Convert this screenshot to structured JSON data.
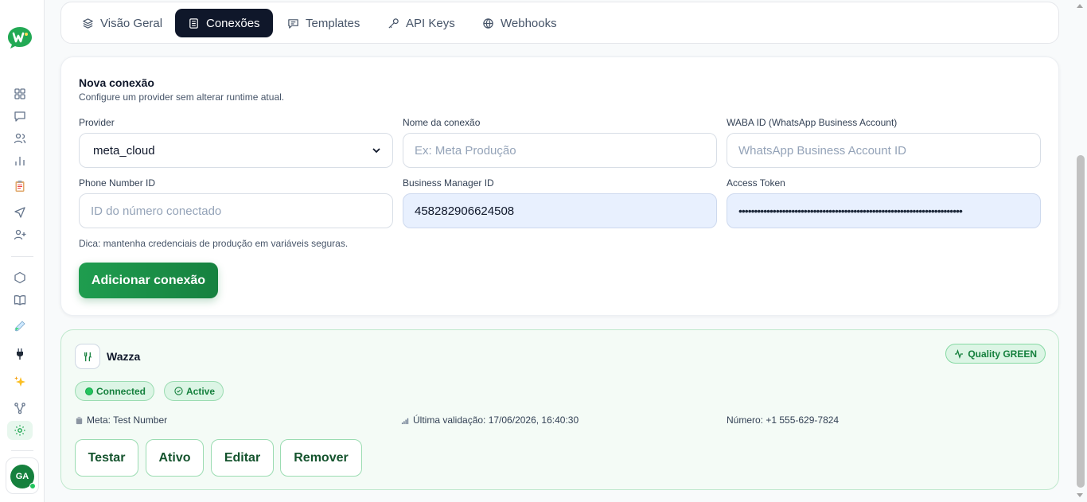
{
  "tabs": [
    {
      "label": "Visão Geral",
      "icon": "layers-icon",
      "active": false
    },
    {
      "label": "Conexões",
      "icon": "plug-list-icon",
      "active": true
    },
    {
      "label": "Templates",
      "icon": "message-square-icon",
      "active": false
    },
    {
      "label": "API Keys",
      "icon": "key-icon",
      "active": false
    },
    {
      "label": "Webhooks",
      "icon": "webhook-icon",
      "active": false
    }
  ],
  "sidebar": {
    "user_initials": "GA",
    "items": [
      "dashboard-icon",
      "chat-icon",
      "contacts-icon",
      "reports-icon",
      "clipboard-icon",
      "send-icon",
      "add-user-icon",
      "box-icon",
      "book-icon",
      "test-tube-icon",
      "plug-icon",
      "sparkles-icon",
      "flow-icon",
      "settings-icon"
    ]
  },
  "form": {
    "title": "Nova conexão",
    "subtitle": "Configure um provider sem alterar runtime atual.",
    "provider_label": "Provider",
    "provider_value": "meta_cloud",
    "name_label": "Nome da conexão",
    "name_placeholder": "Ex: Meta Produção",
    "waba_label": "WABA ID (WhatsApp Business Account)",
    "waba_placeholder": "WhatsApp Business Account ID",
    "phone_label": "Phone Number ID",
    "phone_placeholder": "ID do número conectado",
    "bm_label": "Business Manager ID",
    "bm_value": "458282906624508",
    "token_label": "Access Token",
    "token_value": "••••••••••••••••••••••••••••••••••••••••••••••••••••••••••••••••••••••••",
    "hint": "Dica: mantenha credenciais de produção em variáveis seguras.",
    "submit_label": "Adicionar conexão"
  },
  "connection": {
    "name": "Wazza",
    "quality": "Quality GREEN",
    "status_connected": "Connected",
    "status_active": "Active",
    "meta_label": "Meta: Test Number",
    "validation_label": "Última validação: 17/06/2026, 16:40:30",
    "number_label": "Número: +1 555-629-7824",
    "actions": [
      "Testar",
      "Ativo",
      "Editar",
      "Remover"
    ]
  },
  "colors": {
    "brand_green": "#16a34a",
    "tab_active_bg": "#0f172a",
    "connection_bg": "#f4fbf6"
  }
}
